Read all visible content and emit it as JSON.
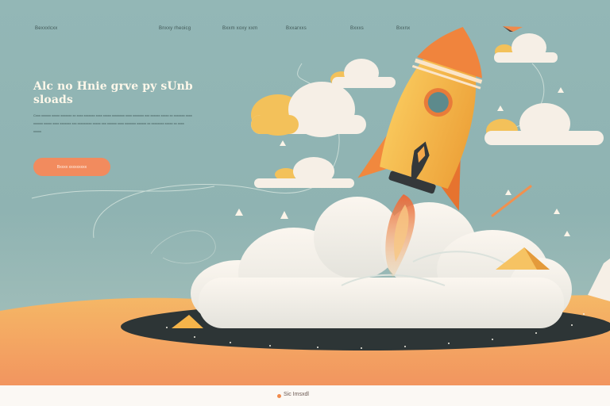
{
  "nav": {
    "items": [
      {
        "label": "Bexxxlcxx"
      },
      {
        "label": "Bnxxy rheoicg"
      },
      {
        "label": "Bxxm xoxy xxm"
      },
      {
        "label": "Bxxarxxs"
      },
      {
        "label": "Bxxxs"
      },
      {
        "label": "Bxxnx"
      }
    ]
  },
  "hero": {
    "headline": "Alc no Hnie grve py sUnb sloads",
    "paragraph": "Cxxx xxxxxx xxxxx xxxxxxx xx xxxx xxxxxxx xxxx xxxxx xxxxxxxx xxxx xxxxxxx xxx xxxxxx xxxxx xx xxxxxxx xxxx xxxxxx xxxxx xxxx xxxxxxx xxx xxxxxxxxx xxxxx xxx xxxxxx xxxx xxxxxxx xxxxxx xx xxxxxxxx xxxxx xx xxxx xxxxx",
    "cta_label": "Bxxxx xxxxxxxxx"
  },
  "footer": {
    "text": "Sic Imsxdl"
  },
  "colors": {
    "sky": "#93b7b6",
    "accent": "#f28b5e",
    "rocket_body": "#f3b144",
    "ground": "#f3a15e",
    "cloud": "#f6efe6"
  }
}
